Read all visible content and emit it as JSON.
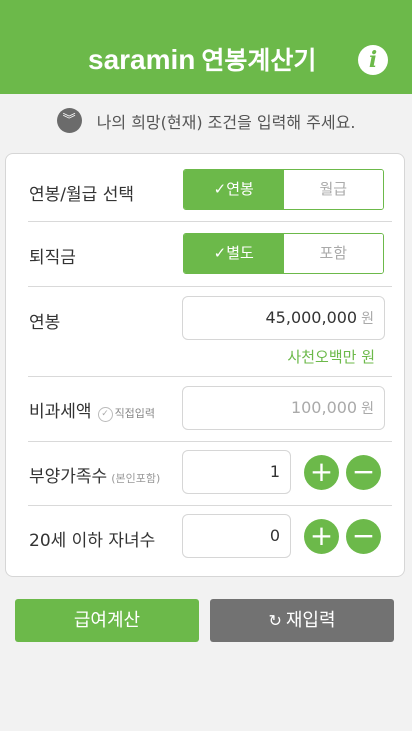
{
  "header": {
    "brand": "saramin",
    "title": "연봉계산기",
    "info_icon": "i"
  },
  "hint": {
    "icon": "chevrons-down-icon",
    "text": "나의 희망(현재) 조건을 입력해 주세요."
  },
  "form": {
    "pay_type": {
      "label": "연봉/월급 선택",
      "options": [
        "✓연봉",
        "월급"
      ],
      "selected": "연봉"
    },
    "severance": {
      "label": "퇴직금",
      "options": [
        "✓별도",
        "포함"
      ],
      "selected": "별도"
    },
    "salary": {
      "label": "연봉",
      "value": "45,000,000",
      "unit": "원",
      "reading": "사천오백만 원"
    },
    "nontax": {
      "label": "비과세액",
      "direct_input_label": "직접입력",
      "value": "100,000",
      "unit": "원"
    },
    "dependents": {
      "label": "부양가족수",
      "note": "(본인포함)",
      "value": "1",
      "plus": "+",
      "minus": "−"
    },
    "children": {
      "label": "20세 이하 자녀수",
      "value": "0",
      "plus": "+",
      "minus": "−"
    }
  },
  "actions": {
    "calculate": "급여계산",
    "reset_icon": "↻",
    "reset": "재입력"
  },
  "colors": {
    "accent": "#6cb94a",
    "reset_button": "#727272"
  }
}
